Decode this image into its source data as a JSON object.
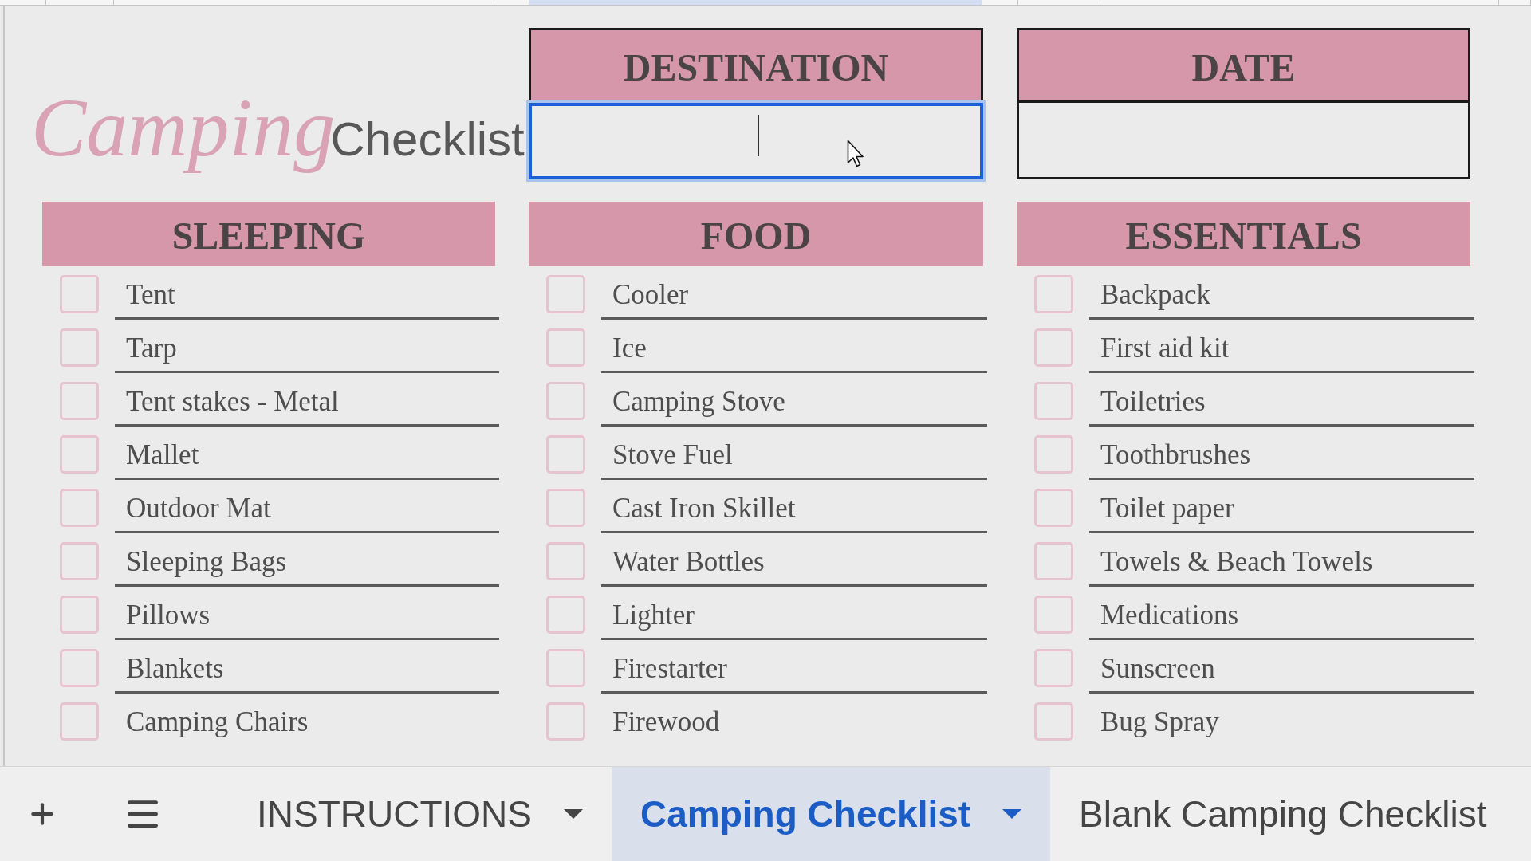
{
  "title": {
    "script": "Camping",
    "word": "Checklist"
  },
  "fields": [
    {
      "label": "DESTINATION",
      "focused": true
    },
    {
      "label": "DATE",
      "focused": false
    }
  ],
  "categories": [
    {
      "title": "SLEEPING",
      "items": [
        {
          "label": "Tent",
          "checked": false
        },
        {
          "label": "Tarp",
          "checked": false
        },
        {
          "label": "Tent stakes - Metal",
          "checked": false
        },
        {
          "label": "Mallet",
          "checked": false
        },
        {
          "label": "Outdoor Mat",
          "checked": false
        },
        {
          "label": "Sleeping Bags",
          "checked": false
        },
        {
          "label": "Pillows",
          "checked": false
        },
        {
          "label": "Blankets",
          "checked": false
        },
        {
          "label": "Camping Chairs",
          "checked": false
        }
      ]
    },
    {
      "title": "FOOD",
      "items": [
        {
          "label": "Cooler",
          "checked": false
        },
        {
          "label": "Ice",
          "checked": false
        },
        {
          "label": "Camping Stove",
          "checked": false
        },
        {
          "label": "Stove Fuel",
          "checked": false
        },
        {
          "label": "Cast Iron Skillet",
          "checked": false
        },
        {
          "label": "Water Bottles",
          "checked": false
        },
        {
          "label": "Lighter",
          "checked": false
        },
        {
          "label": "Firestarter",
          "checked": false
        },
        {
          "label": "Firewood",
          "checked": false
        }
      ]
    },
    {
      "title": "ESSENTIALS",
      "items": [
        {
          "label": "Backpack",
          "checked": false
        },
        {
          "label": "First aid kit",
          "checked": false
        },
        {
          "label": "Toiletries",
          "checked": false
        },
        {
          "label": "Toothbrushes",
          "checked": false
        },
        {
          "label": "Toilet paper",
          "checked": false
        },
        {
          "label": "Towels & Beach Towels",
          "checked": false
        },
        {
          "label": "Medications",
          "checked": false
        },
        {
          "label": "Sunscreen",
          "checked": false
        },
        {
          "label": "Bug Spray",
          "checked": false
        }
      ]
    }
  ],
  "sheet_tabs": [
    {
      "label": "INSTRUCTIONS",
      "selected": false,
      "dropdown": true
    },
    {
      "label": "Camping Checklist",
      "selected": true,
      "dropdown": true
    },
    {
      "label": "Blank Camping Checklist",
      "selected": false,
      "dropdown": false
    }
  ]
}
